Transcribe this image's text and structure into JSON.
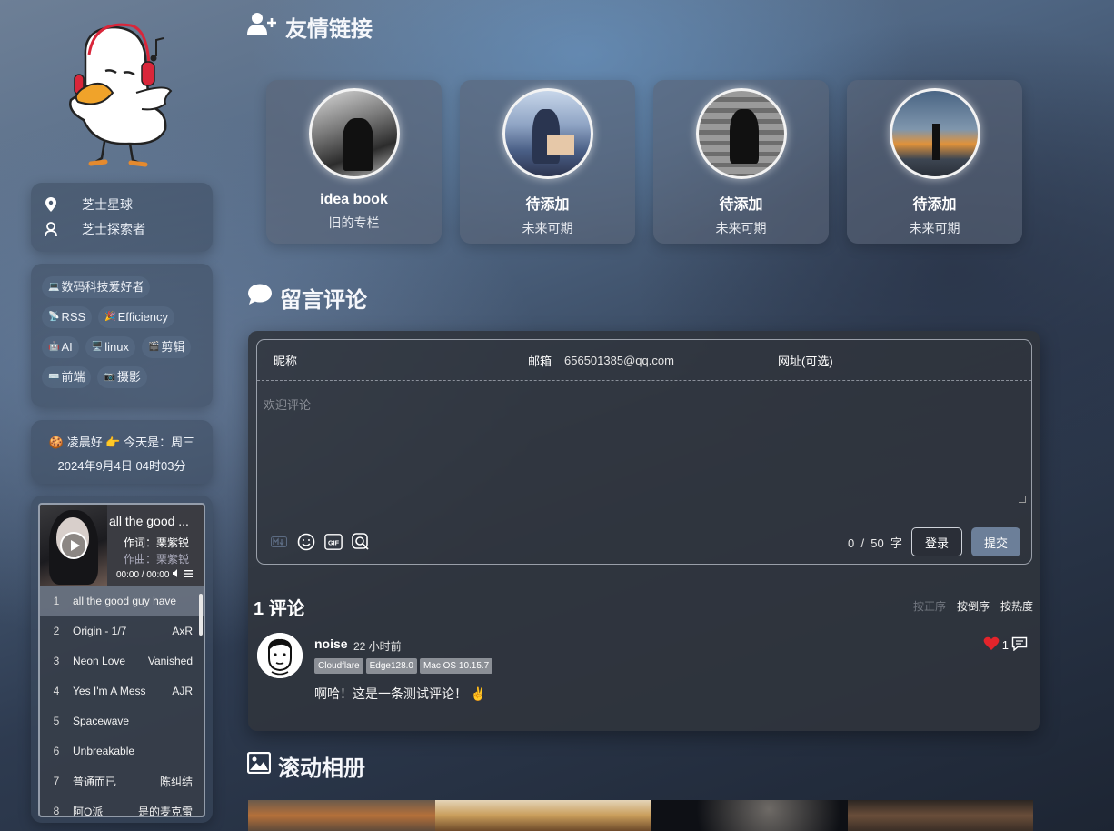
{
  "sidebar": {
    "location": "芝士星球",
    "role": "芝士探索者",
    "tags": [
      [
        {
          "emoji": "💻",
          "label": "数码科技爱好者"
        }
      ],
      [
        {
          "emoji": "📡",
          "label": "RSS"
        },
        {
          "emoji": "🎉",
          "label": "Efficiency"
        }
      ],
      [
        {
          "emoji": "🤖",
          "label": "AI"
        },
        {
          "emoji": "🖥️",
          "label": "linux"
        },
        {
          "emoji": "🎬",
          "label": "剪辑"
        }
      ],
      [
        {
          "emoji": "⌨️",
          "label": "前端"
        },
        {
          "emoji": "📷",
          "label": "摄影"
        }
      ]
    ],
    "greeting_line1": "🍪 凌晨好 👉 今天是：周三",
    "greeting_line2": "2024年9月4日 04时03分"
  },
  "player": {
    "title": "all the good ...",
    "lyricist": "作词：栗紫锐",
    "composer": "作曲：栗紫锐",
    "time": "00:00 / 00:00",
    "tracks": [
      {
        "num": "1",
        "name": "all the good guy have",
        "artist": ""
      },
      {
        "num": "2",
        "name": "Origin - 1/7",
        "artist": "AxR"
      },
      {
        "num": "3",
        "name": "Neon Love",
        "artist": "Vanished"
      },
      {
        "num": "4",
        "name": "Yes I'm A Mess",
        "artist": "AJR"
      },
      {
        "num": "5",
        "name": "Spacewave",
        "artist": ""
      },
      {
        "num": "6",
        "name": "Unbreakable",
        "artist": ""
      },
      {
        "num": "7",
        "name": "普通而已",
        "artist": "陈纠结"
      },
      {
        "num": "8",
        "name": "阿Q派",
        "artist": "是的麦克雷"
      }
    ]
  },
  "friends": {
    "title": "友情链接",
    "cards": [
      {
        "name": "idea book",
        "desc": "旧的专栏"
      },
      {
        "name": "待添加",
        "desc": "未来可期"
      },
      {
        "name": "待添加",
        "desc": "未来可期"
      },
      {
        "name": "待添加",
        "desc": "未来可期"
      }
    ]
  },
  "comments": {
    "title": "留言评论",
    "nick_label": "昵称",
    "email_label": "邮箱",
    "email_value": "656501385@qq.com",
    "url_label": "网址(可选)",
    "placeholder": "欢迎评论",
    "counter": "0  /  50  字",
    "login": "登录",
    "submit": "提交",
    "count_title": "1 评论",
    "sort": [
      "按正序",
      "按倒序",
      "按热度"
    ],
    "items": [
      {
        "author": "noise",
        "time": "22 小时前",
        "badges": [
          "Cloudflare",
          "Edge128.0",
          "Mac OS 10.15.7"
        ],
        "text": "啊哈！这是一条测试评论！ ✌️",
        "likes": "1"
      }
    ]
  },
  "album": {
    "title": "滚动相册"
  }
}
